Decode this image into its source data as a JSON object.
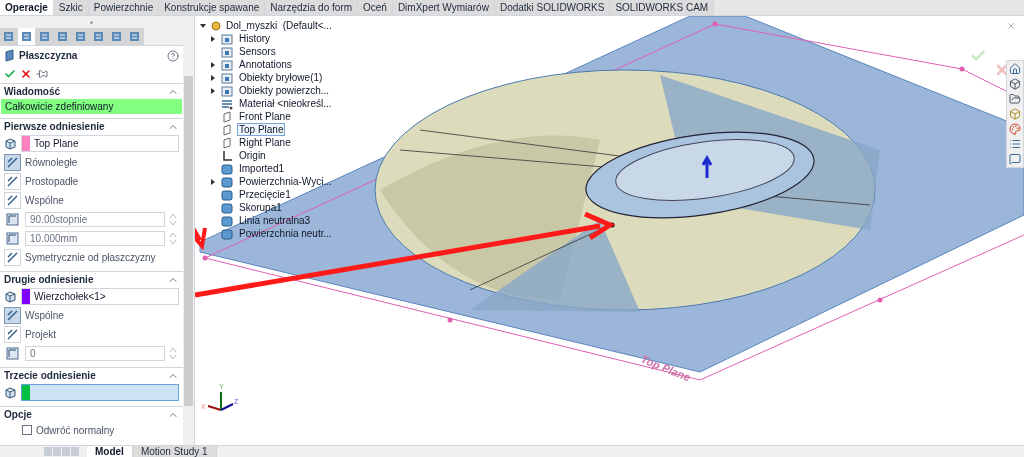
{
  "tabs": [
    {
      "label": "Operacje",
      "selected": true
    },
    {
      "label": "Szkic",
      "selected": false
    },
    {
      "label": "Powierzchnie",
      "selected": false
    },
    {
      "label": "Konstrukcje spawane",
      "selected": false
    },
    {
      "label": "Narzędzia do form",
      "selected": false
    },
    {
      "label": "Oceń",
      "selected": false
    },
    {
      "label": "DimXpert Wymiarów",
      "selected": false
    },
    {
      "label": "Dodatki SOLIDWORKS",
      "selected": false
    },
    {
      "label": "SOLIDWORKS CAM",
      "selected": false
    }
  ],
  "panel_tabs": [
    {
      "selected": false
    },
    {
      "selected": true
    },
    {
      "selected": false
    },
    {
      "selected": false
    },
    {
      "selected": false
    },
    {
      "selected": false
    },
    {
      "selected": false
    },
    {
      "selected": false
    }
  ],
  "property_manager": {
    "title": "Płaszczyzna",
    "sections": [
      {
        "kind": "message",
        "heading": "Wiadomość",
        "expanded": true,
        "message": "Całkowicie zdefiniowany"
      },
      {
        "kind": "reference",
        "heading": "Pierwsze odniesienie",
        "expanded": true,
        "field": {
          "value": "Top Plane",
          "color": "#ff80c0",
          "active": false
        },
        "options": [
          {
            "kind": "toggle",
            "label": "Równoległe",
            "selected": true
          },
          {
            "kind": "toggle",
            "label": "Prostopadłe",
            "selected": false
          },
          {
            "kind": "toggle",
            "label": "Wspólne",
            "selected": false
          },
          {
            "kind": "spinner",
            "value": "90.00stopnie",
            "disabled": true
          },
          {
            "kind": "spinner",
            "value": "10.000mm",
            "disabled": true
          },
          {
            "kind": "toggle",
            "label": "Symetrycznie od płaszczyzny",
            "selected": false
          }
        ]
      },
      {
        "kind": "reference",
        "heading": "Drugie odniesienie",
        "expanded": true,
        "field": {
          "value": "Wierzchołek<1>",
          "color": "#8000ff",
          "active": false
        },
        "options": [
          {
            "kind": "toggle",
            "label": "Wspólne",
            "selected": true
          },
          {
            "kind": "toggle",
            "label": "Projekt",
            "selected": false
          },
          {
            "kind": "spinner",
            "value": "0",
            "disabled": true
          }
        ]
      },
      {
        "kind": "reference",
        "heading": "Trzecie odniesienie",
        "expanded": true,
        "field": {
          "color": "#00c040",
          "active": true
        }
      },
      {
        "kind": "options",
        "heading": "Opcje",
        "expanded": true,
        "checkboxes": [
          {
            "label": "Odwróć normalny",
            "checked": false
          }
        ]
      }
    ]
  },
  "feature_tree": {
    "label": "Dol_myszki  (Default<...",
    "expanded": true,
    "children": [
      {
        "label": "History",
        "kind": "folder",
        "expanded": false,
        "selected": false
      },
      {
        "label": "Sensors",
        "kind": "folder",
        "selected": false
      },
      {
        "label": "Annotations",
        "kind": "folder",
        "expanded": false,
        "selected": false
      },
      {
        "label": "Obiekty bryłowe(1)",
        "kind": "folder",
        "expanded": false,
        "selected": false
      },
      {
        "label": "Obiekty powierzch...",
        "kind": "folder",
        "expanded": false,
        "selected": false
      },
      {
        "label": "Materiał <nieokreśl...",
        "kind": "material",
        "selected": false
      },
      {
        "label": "Front Plane",
        "kind": "plane",
        "selected": false
      },
      {
        "label": "Top Plane",
        "kind": "plane",
        "selected": true
      },
      {
        "label": "Right Plane",
        "kind": "plane",
        "selected": false
      },
      {
        "label": "Origin",
        "kind": "origin",
        "selected": false
      },
      {
        "label": "Imported1",
        "kind": "feature",
        "selected": false
      },
      {
        "label": "Powierzchnia-Wyci...",
        "kind": "feature",
        "expanded": false,
        "selected": false
      },
      {
        "label": "Przecięcie1",
        "kind": "feature",
        "selected": false
      },
      {
        "label": "Skorupa1",
        "kind": "feature",
        "selected": false
      },
      {
        "label": "Linia neutralna3",
        "kind": "feature",
        "selected": false
      },
      {
        "label": "Powierzchnia neutr...",
        "kind": "feature",
        "selected": false
      }
    ]
  },
  "viewport": {
    "plane_label": "Top Plane",
    "axes": [
      "X",
      "Y",
      "Z"
    ]
  },
  "bottom_tabs": [
    {
      "label": "Model",
      "selected": true
    },
    {
      "label": "Motion Study 1",
      "selected": false
    }
  ]
}
